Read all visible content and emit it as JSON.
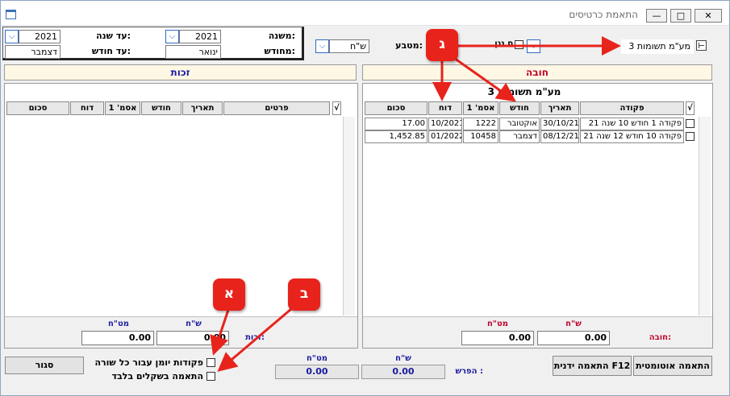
{
  "window": {
    "title": "התאמת כרטיסים",
    "buttons": {
      "minimize": "—",
      "maximize": "□",
      "close": "✕"
    }
  },
  "filters": {
    "from_year_label": "משנה:",
    "from_year": "2021",
    "to_year_label": "עד שנה:",
    "to_year": "2021",
    "from_month_label": "מחודש:",
    "from_month": "ינואר",
    "to_month_label": "עד חודש:",
    "to_month": "דצמבר",
    "currency_label": "מטבע:",
    "currency": "ש\"ח",
    "partial_label": "ס נגן",
    "vat_account": "מע\"מ תשומות 3"
  },
  "credit": {
    "header": "זכות",
    "columns": [
      "סכום",
      "דוח",
      "אסמ' 1",
      "חודש",
      "תאריך",
      "פרטים"
    ],
    "rows": [],
    "currency_labels": {
      "shekel": "ש\"ח",
      "foreign": "מט\"ח"
    },
    "total_label": "זכות:",
    "total_shekel": "0.00",
    "total_foreign": "0.00"
  },
  "debit": {
    "header": "חובה",
    "account_title": "מע\"מ תשומות 3",
    "columns": [
      "סכום",
      "דוח",
      "אסמ' 1",
      "חודש",
      "תאריך",
      "פקודה"
    ],
    "rows": [
      {
        "amount": "17.00",
        "report": "10/2021",
        "ref1": "1222",
        "month": "אוקטובר",
        "date": "30/10/21",
        "entry": "פקודה 1  חודש 10  שנה 21"
      },
      {
        "amount": "1,452.85",
        "report": "01/2022",
        "ref1": "10458",
        "month": "דצמבר",
        "date": "08/12/21",
        "entry": "פקודה 10  חודש 12  שנה 21"
      }
    ],
    "currency_labels": {
      "shekel": "ש\"ח",
      "foreign": "מט\"ח"
    },
    "total_label": "חובה:",
    "total_shekel": "0.00",
    "total_foreign": "0.00"
  },
  "footer": {
    "difference_label": "הפרש :",
    "diff_currency_labels": {
      "shekel": "ש\"ח",
      "foreign": "מט\"ח"
    },
    "diff_shekel": "0.00",
    "diff_foreign": "0.00",
    "auto_match_button": "התאמה אוטומטית",
    "manual_match_button": "התאמה ידנית F12",
    "close_button": "סגור",
    "opt_journal_per_row": "פקודות יומן עבור כל שורה",
    "opt_shekel_only": "התאמה בשקלים בלבד"
  },
  "callouts": {
    "a": "א",
    "b": "ב",
    "c": "ג"
  },
  "colors": {
    "accent_blue": "#1a1aa0",
    "callout_red": "#e8231c",
    "debit_header": "#c0002a"
  }
}
